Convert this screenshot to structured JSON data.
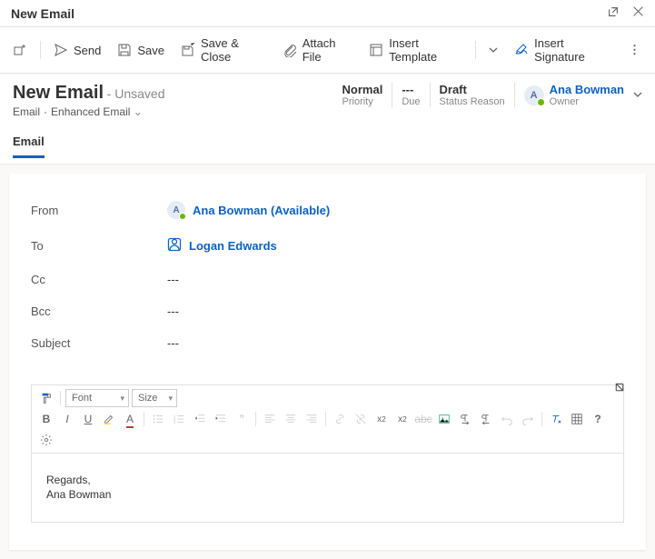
{
  "window": {
    "title": "New Email"
  },
  "commands": {
    "send": "Send",
    "save": "Save",
    "save_close": "Save & Close",
    "attach": "Attach File",
    "insert_template": "Insert Template",
    "insert_signature": "Insert Signature"
  },
  "header": {
    "title": "New Email",
    "status": "- Unsaved",
    "entity": "Email",
    "form": "Enhanced Email",
    "meta": {
      "priority": {
        "value": "Normal",
        "label": "Priority"
      },
      "due": {
        "value": "---",
        "label": "Due"
      },
      "status_reason": {
        "value": "Draft",
        "label": "Status Reason"
      }
    },
    "owner": {
      "initial": "A",
      "name": "Ana Bowman",
      "label": "Owner"
    }
  },
  "tab": {
    "email": "Email"
  },
  "fields": {
    "from": {
      "label": "From",
      "initial": "A",
      "name": "Ana Bowman (Available)"
    },
    "to": {
      "label": "To",
      "name": "Logan Edwards"
    },
    "cc": {
      "label": "Cc",
      "value": "---"
    },
    "bcc": {
      "label": "Bcc",
      "value": "---"
    },
    "subject": {
      "label": "Subject",
      "value": "---"
    }
  },
  "editor": {
    "font_label": "Font",
    "size_label": "Size",
    "body_line1": "Regards,",
    "body_line2": "Ana Bowman"
  }
}
